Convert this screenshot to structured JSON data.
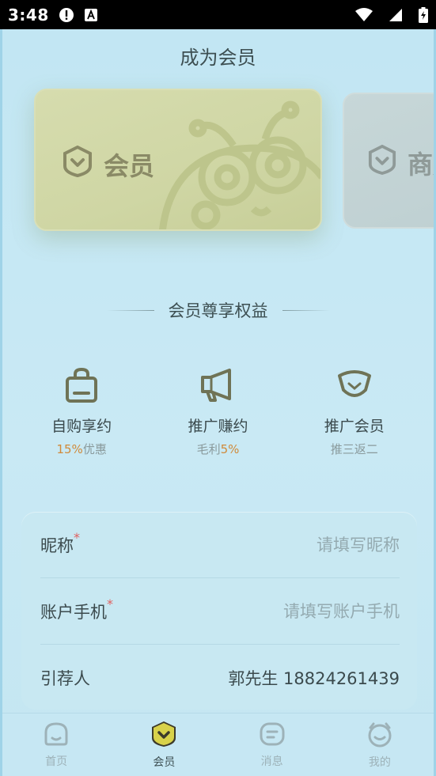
{
  "status_bar": {
    "time": "3:48"
  },
  "page": {
    "title": "成为会员"
  },
  "cards": [
    {
      "label": "会员"
    },
    {
      "label": "商户"
    }
  ],
  "benefits_header": "会员尊享权益",
  "benefits": [
    {
      "title": "自购享约",
      "sub_highlight": "15%",
      "sub_text": "优惠"
    },
    {
      "title": "推广赚约",
      "sub_text": "毛利",
      "sub_highlight": "5%"
    },
    {
      "title": "推广会员",
      "sub_text": "推三返二"
    }
  ],
  "form": {
    "nickname": {
      "label": "昵称",
      "required_mark": "*",
      "placeholder": "请填写昵称"
    },
    "phone": {
      "label": "账户手机",
      "required_mark": "*",
      "placeholder": "请填写账户手机"
    },
    "referrer": {
      "label": "引荐人",
      "value": "郭先生 18824261439"
    }
  },
  "tabbar": [
    {
      "label": "首页",
      "icon": "home-icon"
    },
    {
      "label": "会员",
      "icon": "member-icon",
      "active": true
    },
    {
      "label": "消息",
      "icon": "message-icon"
    },
    {
      "label": "我的",
      "icon": "profile-icon"
    }
  ],
  "colors": {
    "accent": "#d08a3a",
    "card_member": "#d6dcae",
    "icon_olive": "#6f7356"
  }
}
